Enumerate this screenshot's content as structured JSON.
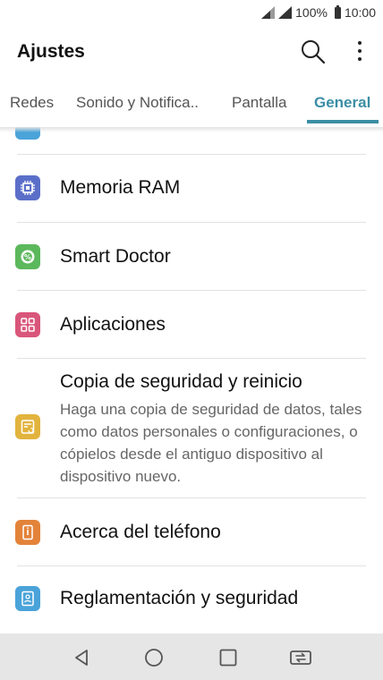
{
  "status_bar": {
    "battery": "100%",
    "time": "10:00"
  },
  "app_bar": {
    "title": "Ajustes"
  },
  "tabs": [
    {
      "label": "Redes"
    },
    {
      "label": "Sonido y Notifica.."
    },
    {
      "label": "Pantalla"
    },
    {
      "label": "General",
      "active": true
    }
  ],
  "list": {
    "items": [
      {
        "title": "Memoria RAM",
        "icon": "memory-chip-icon",
        "color": "#5b6fc9"
      },
      {
        "title": "Smart Doctor",
        "icon": "smart-doctor-icon",
        "color": "#5cb85c"
      },
      {
        "title": "Aplicaciones",
        "icon": "apps-grid-icon",
        "color": "#d9567a"
      },
      {
        "title": "Copia de seguridad y reinicio",
        "description": "Haga una copia de seguridad de datos, tales como datos personales o configuraciones, o cópielos desde el antiguo dispositivo al dispositivo nuevo.",
        "icon": "backup-icon",
        "color": "#e2b43e"
      },
      {
        "title": "Acerca del teléfono",
        "icon": "phone-info-icon",
        "color": "#e3833a"
      },
      {
        "title": "Reglamentación y seguridad",
        "icon": "regulatory-icon",
        "color": "#4aa3d9"
      }
    ]
  },
  "nav": {
    "back_icon": "back-icon",
    "home_icon": "home-icon",
    "recents_icon": "recents-icon",
    "dual_window_icon": "dual-window-icon"
  }
}
